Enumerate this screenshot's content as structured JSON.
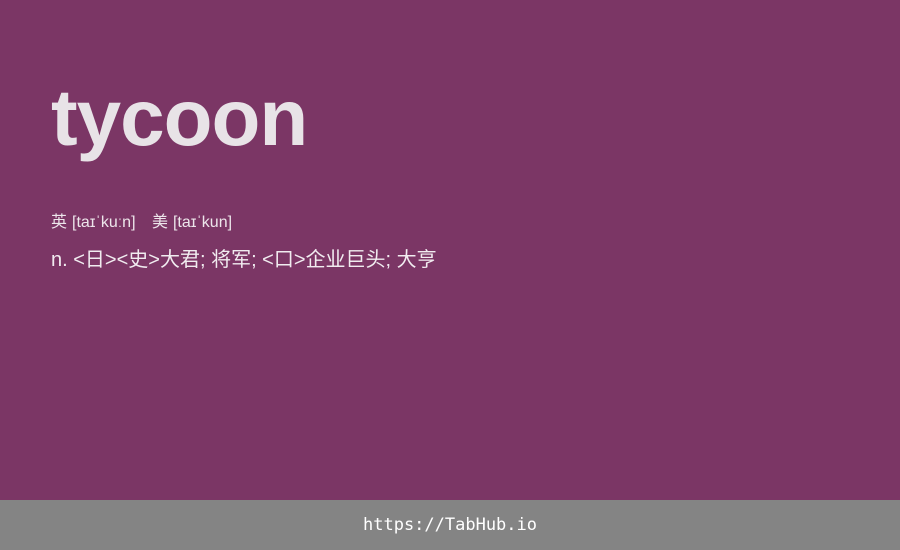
{
  "word": "tycoon",
  "pronunciation": {
    "uk_label": "英",
    "uk_ipa": "[taɪˈkuːn]",
    "us_label": "美",
    "us_ipa": "[taɪˈkun]"
  },
  "definition": "n. <日><史>大君; 将军; <口>企业巨头; 大亨",
  "footer": {
    "link_text": "https://TabHub.io"
  },
  "colors": {
    "background": "#7b3665",
    "word_text": "#e8e3e7",
    "footer_background": "#848484",
    "footer_text": "#ffffff"
  }
}
